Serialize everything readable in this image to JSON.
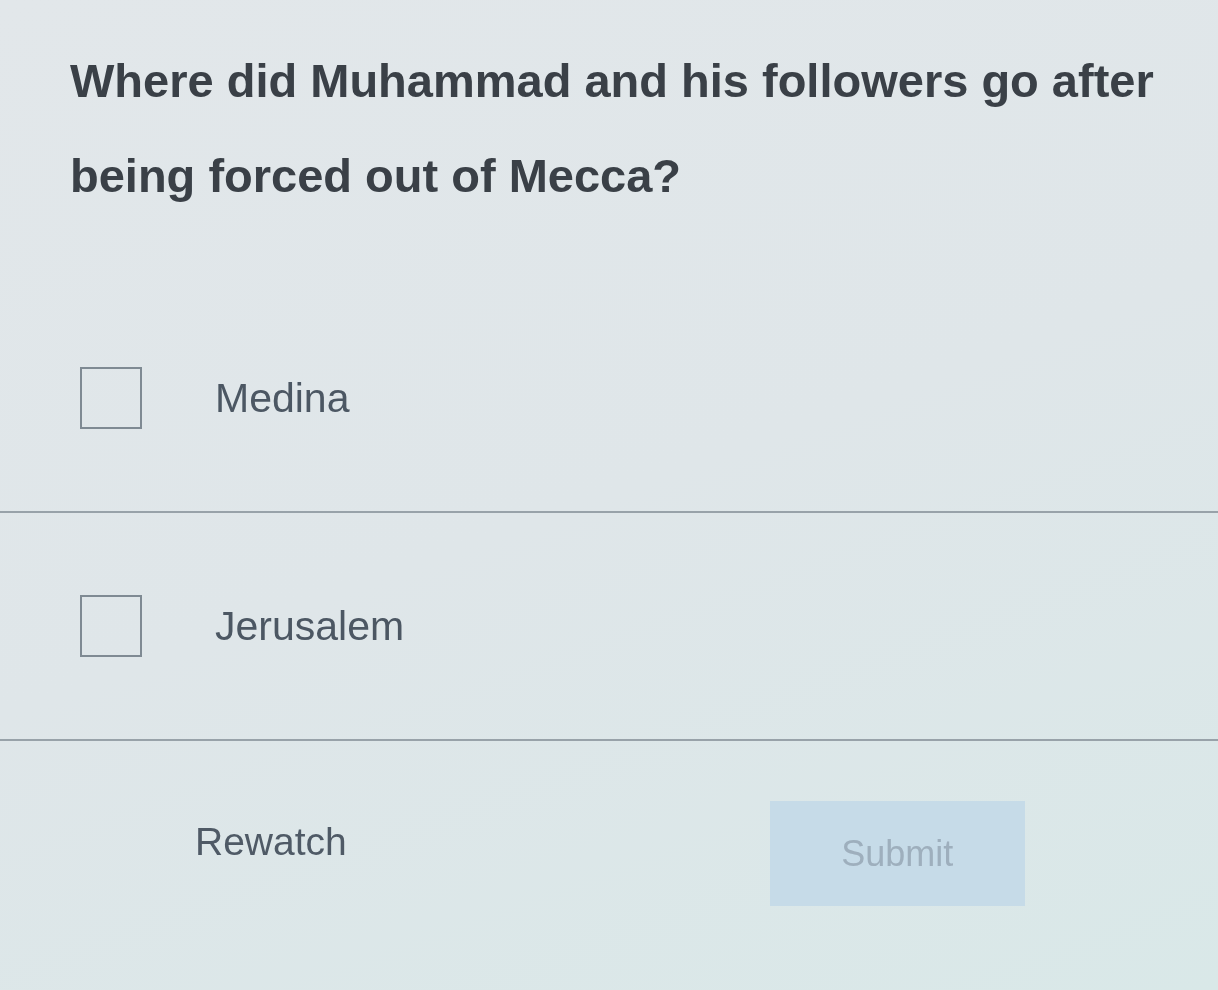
{
  "question": {
    "text": "Where did Muhammad and his followers go after being forced out of Mecca?"
  },
  "options": [
    {
      "label": "Medina",
      "checked": false
    },
    {
      "label": "Jerusalem",
      "checked": false
    }
  ],
  "actions": [
    {
      "kind": "link",
      "label": "Rewatch",
      "disabled": false
    },
    {
      "kind": "primary",
      "label": "Submit",
      "disabled": true
    }
  ]
}
